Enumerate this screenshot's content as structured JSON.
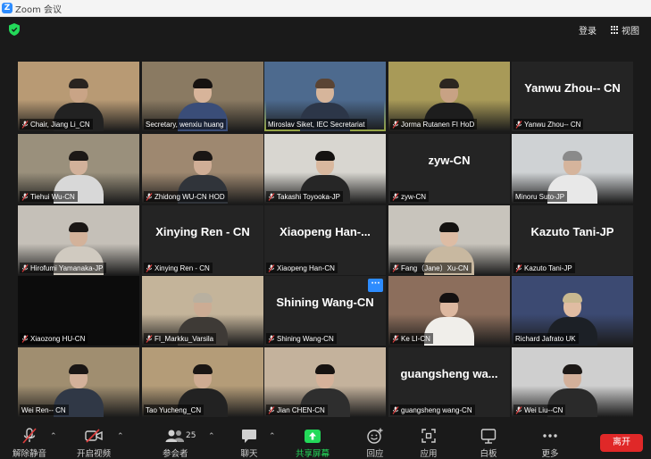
{
  "window": {
    "logo": "Z",
    "title": "Zoom 会议"
  },
  "topbar": {
    "login": "登录",
    "view": "视图"
  },
  "participants": [
    {
      "name": "Chair, Jiang Li_CN",
      "muted": true,
      "bg": "#b89a74",
      "skin": "#c9a486",
      "hair": "#2a2420",
      "shirt": "#222222"
    },
    {
      "name": "Secretary, wenxiu huang",
      "muted": false,
      "bg": "#8a7a62",
      "skin": "#d7b49a",
      "hair": "#161210",
      "shirt": "#3a4d78"
    },
    {
      "name": "Miroslav Siket, IEC Secretariat",
      "muted": false,
      "active": true,
      "bg": "#4d6a8e",
      "skin": "#d6b59b",
      "hair": "#5a4434",
      "shirt": "#2c3648"
    },
    {
      "name": "Jorma Rutanen FI HoD",
      "muted": true,
      "bg": "#a89a58",
      "skin": "#c8a284",
      "hair": "#2c2620",
      "shirt": "#1d1d1d"
    },
    {
      "name": "Yanwu Zhou-- CN",
      "muted": true,
      "bigname": "Yanwu Zhou-- CN"
    },
    {
      "name": "Tiehui Wu-CN",
      "muted": true,
      "bg": "#9a907c",
      "skin": "#d2b19a",
      "hair": "#1c1816",
      "shirt": "#d8d8d8"
    },
    {
      "name": "Zhidong WU-CN HOD",
      "muted": true,
      "bg": "#9e8870",
      "skin": "#d0ae96",
      "hair": "#1a1614",
      "shirt": "#30343a"
    },
    {
      "name": "Takashi Toyooka-JP",
      "muted": true,
      "bg": "#d8d6d0",
      "skin": "#d9b89e",
      "hair": "#141210",
      "shirt": "#262626"
    },
    {
      "name": "zyw-CN",
      "muted": true,
      "bigname": "zyw-CN"
    },
    {
      "name": "Minoru Suto-JP",
      "muted": false,
      "bg": "#cfd2d4",
      "skin": "#d5b49c",
      "hair": "#8a8a8a",
      "shirt": "#e8e8e8"
    },
    {
      "name": "Hirofumi Yamanaka-JP",
      "muted": true,
      "bg": "#c5c0b8",
      "skin": "#d3b29a",
      "hair": "#1a1614",
      "shirt": "#d0cac0"
    },
    {
      "name": "Xinying Ren - CN",
      "muted": true,
      "bigname": "Xinying Ren - CN"
    },
    {
      "name": "Xiaopeng Han-CN",
      "muted": true,
      "bigname": "Xiaopeng  Han-..."
    },
    {
      "name": "Fang（Jane）Xu-CN",
      "muted": true,
      "bg": "#c8c4bc",
      "skin": "#ddbca4",
      "hair": "#141210",
      "shirt": "#c8b8a0"
    },
    {
      "name": "Kazuto Tani-JP",
      "muted": true,
      "bigname": "Kazuto Tani-JP"
    },
    {
      "name": "Xiaozong HU-CN",
      "muted": true,
      "black": true
    },
    {
      "name": "FI_Markku_Varsila",
      "muted": true,
      "bg": "#c4b49a",
      "skin": "#ccac94",
      "hair": "#b8b0a0",
      "shirt": "#3e3a36"
    },
    {
      "name": "Shining Wang-CN",
      "muted": true,
      "bigname": "Shining Wang-CN",
      "more": "···"
    },
    {
      "name": "Ke LI-CN",
      "muted": true,
      "bg": "#8c6e5c",
      "skin": "#ddb8a0",
      "hair": "#141010",
      "shirt": "#f0eeea"
    },
    {
      "name": "Richard Jafrato UK",
      "muted": false,
      "bg": "#3c4a72",
      "skin": "#e0bca2",
      "hair": "#c8b890",
      "shirt": "#1c2026"
    },
    {
      "name": "Wei Ren-- CN",
      "muted": false,
      "bg": "#a08e70",
      "skin": "#d3b19a",
      "hair": "#1a1614",
      "shirt": "#303846"
    },
    {
      "name": "Tao Yucheng_CN",
      "muted": false,
      "bg": "#b49c78",
      "skin": "#cfac92",
      "hair": "#1a1614",
      "shirt": "#222222"
    },
    {
      "name": "Jian CHEN-CN",
      "muted": true,
      "bg": "#c4b29c",
      "skin": "#d6b29a",
      "hair": "#161210",
      "shirt": "#2e2e2e"
    },
    {
      "name": "guangsheng wang-CN",
      "muted": true,
      "bigname": "guangsheng  wa..."
    },
    {
      "name": "Wei Liu--CN",
      "muted": true,
      "bg": "#cfcfcf",
      "skin": "#d3b09a",
      "hair": "#1c1816",
      "shirt": "#2a2a2a"
    }
  ],
  "toolbar": {
    "unmute": "解除静音",
    "start_video": "开启视频",
    "participants": "参会者",
    "participant_count": "25",
    "chat": "聊天",
    "share": "共享屏幕",
    "reactions": "回应",
    "apps": "应用",
    "whiteboard": "白板",
    "more": "更多",
    "leave": "离开"
  },
  "colors": {
    "accent_green": "#23d959",
    "leave_red": "#e02828",
    "active_speaker": "#c9dd5a",
    "mute_red": "#e03c3c",
    "brand_blue": "#2d8cff"
  }
}
